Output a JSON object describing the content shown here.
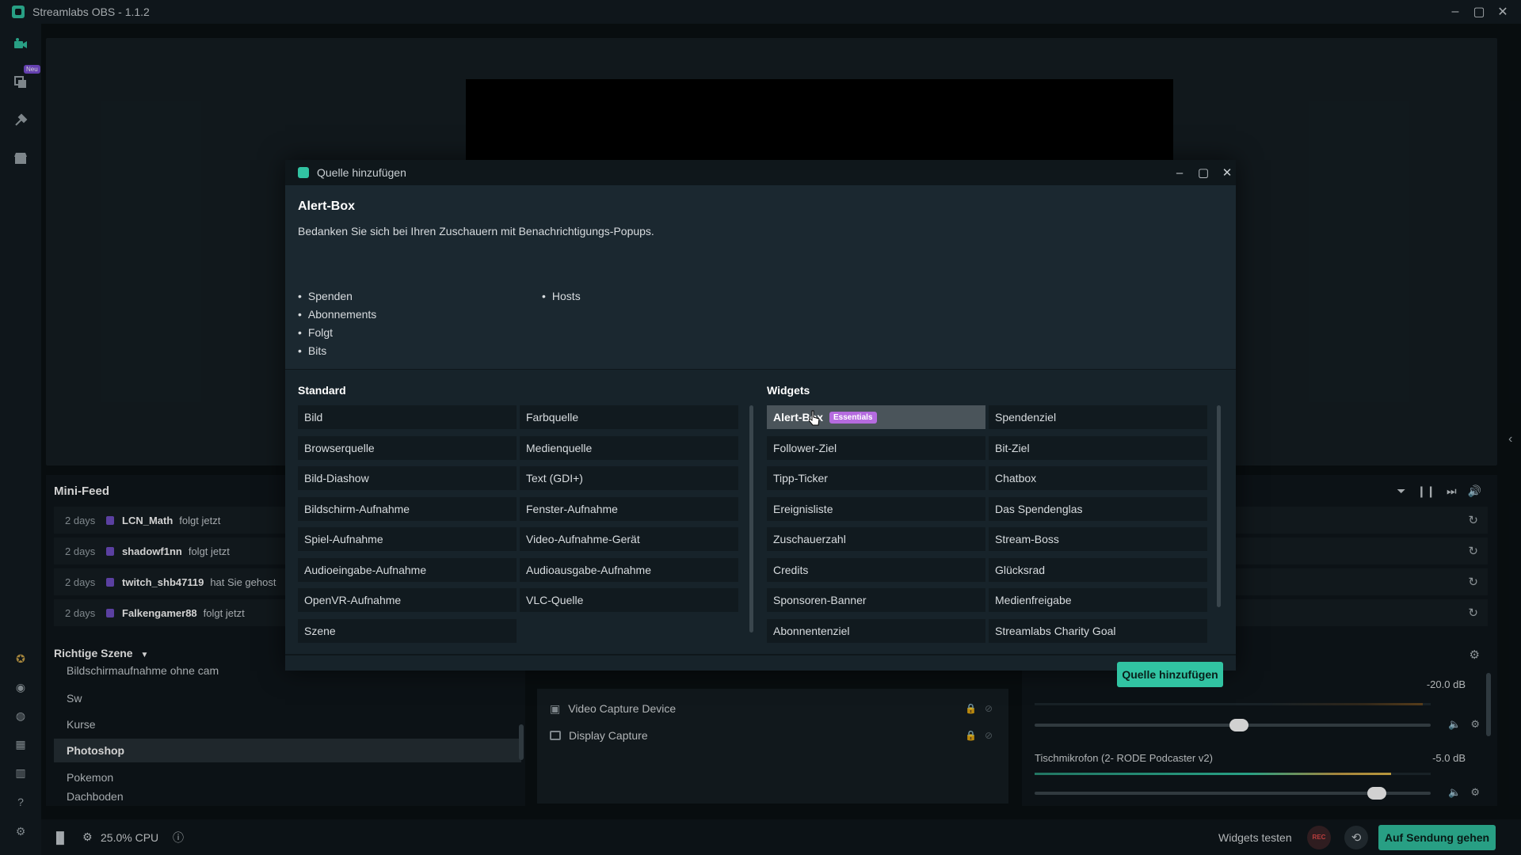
{
  "app": {
    "title": "Streamlabs OBS - 1.1.2",
    "nav_badge": "Neu"
  },
  "mini_feed": {
    "title": "Mini-Feed",
    "items": [
      {
        "when": "2 days",
        "user": "LCN_Math",
        "action": "folgt jetzt"
      },
      {
        "when": "2 days",
        "user": "shadowf1nn",
        "action": "folgt jetzt"
      },
      {
        "when": "2 days",
        "user": "twitch_shb47119",
        "action": "hat Sie gehost"
      },
      {
        "when": "2 days",
        "user": "Falkengamer88",
        "action": "folgt jetzt"
      }
    ]
  },
  "scenes": {
    "header": "Richtige Szene",
    "items": [
      "Bildschirmaufnahme ohne cam",
      "Sw",
      "Kurse",
      "Photoshop",
      "Pokemon",
      "Dachboden"
    ],
    "active": "Photoshop"
  },
  "sources": {
    "items": [
      "Video Capture Device",
      "Display Capture"
    ]
  },
  "mixer": {
    "channel1_db": "-20.0 dB",
    "channel2_name": "Tischmikrofon (2- RODE Podcaster v2)",
    "channel2_db": "-5.0 dB"
  },
  "status": {
    "cpu": "25.0% CPU",
    "widgets_test": "Widgets testen",
    "rec": "REC",
    "go_live": "Auf Sendung gehen"
  },
  "modal": {
    "title": "Quelle hinzufügen",
    "selected_title": "Alert-Box",
    "selected_desc": "Bedanken Sie sich bei Ihren Zuschauern mit Benachrichtigungs-Popups.",
    "features_col1": [
      "Spenden",
      "Abonnements",
      "Folgt",
      "Bits"
    ],
    "features_col2": [
      "Hosts"
    ],
    "standard_header": "Standard",
    "widgets_header": "Widgets",
    "standard": [
      "Bild",
      "Farbquelle",
      "Browserquelle",
      "Medienquelle",
      "Bild-Diashow",
      "Text (GDI+)",
      "Bildschirm-Aufnahme",
      "Fenster-Aufnahme",
      "Spiel-Aufnahme",
      "Video-Aufnahme-Gerät",
      "Audioeingabe-Aufnahme",
      "Audioausgabe-Aufnahme",
      "OpenVR-Aufnahme",
      "VLC-Quelle",
      "Szene"
    ],
    "widgets": [
      "Alert-Box",
      "Spendenziel",
      "Follower-Ziel",
      "Bit-Ziel",
      "Tipp-Ticker",
      "Chatbox",
      "Ereignisliste",
      "Das Spendenglas",
      "Zuschauerzahl",
      "Stream-Boss",
      "Credits",
      "Glücksrad",
      "Sponsoren-Banner",
      "Medienfreigabe",
      "Abonnentenziel",
      "Streamlabs Charity Goal"
    ],
    "essentials_badge": "Essentials",
    "add_button": "Quelle hinzufügen"
  },
  "colors": {
    "accent": "#31c3a2",
    "essentials": "#b56bdf",
    "twitch": "#6f4fc5"
  }
}
